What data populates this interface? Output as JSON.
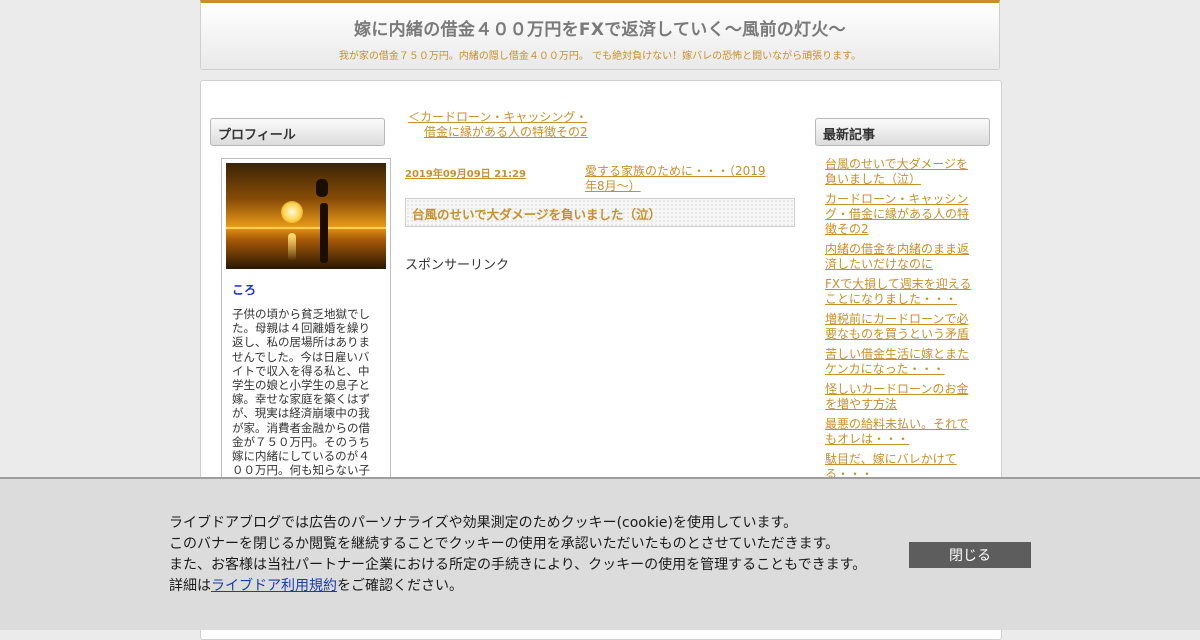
{
  "header": {
    "title": "嫁に内緒の借金４００万円をFXで返済していく～風前の灯火～",
    "description": "我が家の借金７５０万円。内緒の隠し借金４００万円。 でも絶対負けない！嫁バレの恐怖と闘いながら頑張ります。"
  },
  "profile": {
    "heading": "プロフィール",
    "name": "ころ",
    "text": "子供の頃から貧乏地獄でした。母親は４回離婚を繰り返し、私の居場所はありませんでした。今は日雇いバイトで収入を得る私と、中学生の娘と小学生の息子と嫁。幸せな家庭を築くはずが、現実は経済崩壊中の我が家。消費者金融からの借金が７５０万円。そのうち嫁に内緒にしているのが４００万円。何も知らない子"
  },
  "article": {
    "prev_link_line1": "＜カードローン・キャッシング・",
    "prev_link_line2": "借金に縁がある人の特徴その2",
    "date": "2019年09月09日 21:29",
    "next_link": "愛する家族のために・・・（2019年8月～）",
    "title": "台風のせいで大ダメージを負いました（泣）",
    "sponsor": "スポンサーリンク"
  },
  "recent": {
    "heading": "最新記事",
    "items": [
      "台風のせいで大ダメージを負いました（泣）",
      "カードローン・キャッシング・借金に縁がある人の特徴その2",
      "内緒の借金を内緒のまま返済したいだけなのに",
      "FXで大損して週末を迎えることになりました・・・",
      "増税前にカードローンで必要なものを買うという矛盾",
      "苦しい借金生活に嫁とまたケンカになった・・・",
      "怪しいカードローンのお金を増やす方法",
      "最悪の給料未払い。それでもオレは・・・",
      "駄目だ、嫁にバレかけてる・・・"
    ]
  },
  "cookie": {
    "line1": "ライブドアブログでは広告のパーソナライズや効果測定のためクッキー(cookie)を使用しています。",
    "line2": "このバナーを閉じるか閲覧を継続することでクッキーの使用を承認いただいたものとさせていただきます。",
    "line3": "また、お客様は当社パートナー企業における所定の手続きにより、クッキーの使用を管理することもできます。",
    "line4_prefix": "詳細は",
    "line4_link": "ライブドア利用規約",
    "line4_suffix": "をご確認ください。",
    "close_label": "閉じる"
  },
  "colors": {
    "accent": "#c8902a",
    "link_blue": "#1b3ea8",
    "banner_bg": "#dcdcdc",
    "button_bg": "#5d5d5d"
  }
}
